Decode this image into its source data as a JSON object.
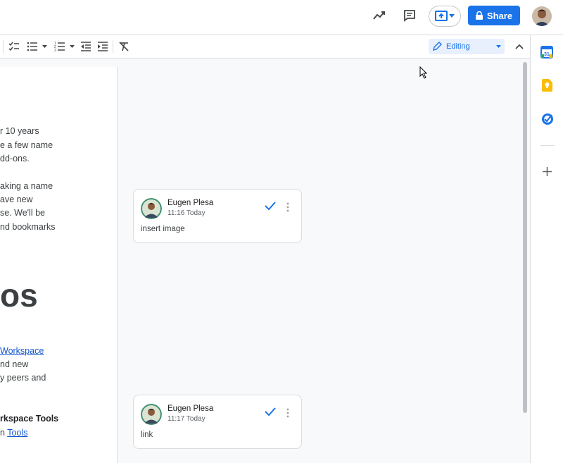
{
  "header": {
    "share_label": "Share"
  },
  "toolbar": {
    "editing_mode": "Editing"
  },
  "document": {
    "lines": [
      "r 10 years",
      "e a few name",
      "dd-ons.",
      "aking a name",
      "ave new",
      "se. We'll be",
      "nd bookmarks"
    ],
    "heading_fragment": "os",
    "link1": "Workspace",
    "lines2": [
      "nd new",
      "y peers and"
    ],
    "bold_line": "rkspace Tools",
    "last_prefix": "n ",
    "link2": "Tools"
  },
  "comments": [
    {
      "author": "Eugen Plesa",
      "time": "11:16 Today",
      "text": "insert image"
    },
    {
      "author": "Eugen Plesa",
      "time": "11:17 Today",
      "text": "link"
    }
  ],
  "colors": {
    "accent": "#1a73e8",
    "link": "#1155cc",
    "background": "#f8f9fa"
  }
}
